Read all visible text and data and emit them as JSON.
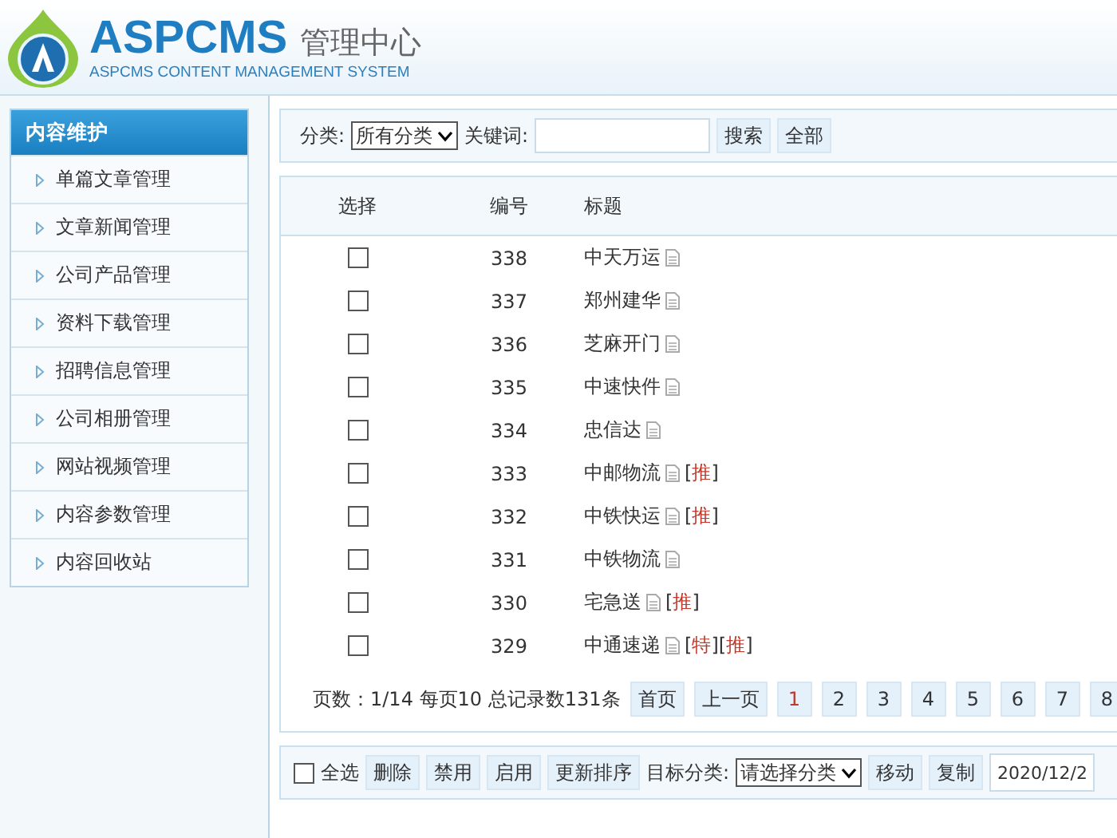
{
  "header": {
    "brand": "ASPCMS",
    "title": "管理中心",
    "subtitle": "ASPCMS CONTENT MANAGEMENT SYSTEM"
  },
  "sidebar": {
    "title": "内容维护",
    "items": [
      {
        "label": "单篇文章管理"
      },
      {
        "label": "文章新闻管理"
      },
      {
        "label": "公司产品管理"
      },
      {
        "label": "资料下载管理"
      },
      {
        "label": "招聘信息管理"
      },
      {
        "label": "公司相册管理"
      },
      {
        "label": "网站视频管理"
      },
      {
        "label": "内容参数管理"
      },
      {
        "label": "内容回收站"
      }
    ]
  },
  "search": {
    "category_label": "分类:",
    "category_value": "所有分类",
    "keyword_label": "关键词:",
    "buttons": [
      "搜索",
      "全部"
    ]
  },
  "table": {
    "columns": [
      "选择",
      "编号",
      "标题"
    ],
    "rows": [
      {
        "checked": false,
        "id": "338",
        "title": "中天万运",
        "tags": []
      },
      {
        "checked": false,
        "id": "337",
        "title": "郑州建华",
        "tags": []
      },
      {
        "checked": false,
        "id": "336",
        "title": "芝麻开门",
        "tags": []
      },
      {
        "checked": false,
        "id": "335",
        "title": "中速快件",
        "tags": []
      },
      {
        "checked": false,
        "id": "334",
        "title": "忠信达",
        "tags": []
      },
      {
        "checked": false,
        "id": "333",
        "title": "中邮物流",
        "tags": [
          {
            "open": "[",
            "label": "推",
            "close": "]"
          }
        ]
      },
      {
        "checked": false,
        "id": "332",
        "title": "中铁快运",
        "tags": [
          {
            "open": "[",
            "label": "推",
            "close": "]"
          }
        ]
      },
      {
        "checked": false,
        "id": "331",
        "title": "中铁物流",
        "tags": []
      },
      {
        "checked": false,
        "id": "330",
        "title": "宅急送",
        "tags": [
          {
            "open": "[",
            "label": "推",
            "close": "]"
          }
        ]
      },
      {
        "checked": false,
        "id": "329",
        "title": "中通速递",
        "tags": [
          {
            "open": "[",
            "label": "特",
            "close": "]"
          },
          {
            "open": "[",
            "label": "推",
            "close": "]"
          }
        ]
      }
    ]
  },
  "pagination": {
    "summary": "页数：1/14 每页10 总记录数131条",
    "buttons": [
      "首页",
      "上一页"
    ],
    "pages": [
      {
        "label": "1",
        "selected": true
      },
      {
        "label": "2",
        "selected": false
      },
      {
        "label": "3",
        "selected": false
      },
      {
        "label": "4",
        "selected": false
      },
      {
        "label": "5",
        "selected": false
      },
      {
        "label": "6",
        "selected": false
      },
      {
        "label": "7",
        "selected": false
      },
      {
        "label": "8",
        "selected": false
      }
    ]
  },
  "actions": {
    "select_all": {
      "label": "全选",
      "checked": false
    },
    "buttons": [
      "删除",
      "禁用",
      "启用",
      "更新排序"
    ],
    "target_label": "目标分类:",
    "target_value": "请选择分类",
    "move_buttons": [
      "移动",
      "复制"
    ],
    "date": "2020/12/2"
  }
}
